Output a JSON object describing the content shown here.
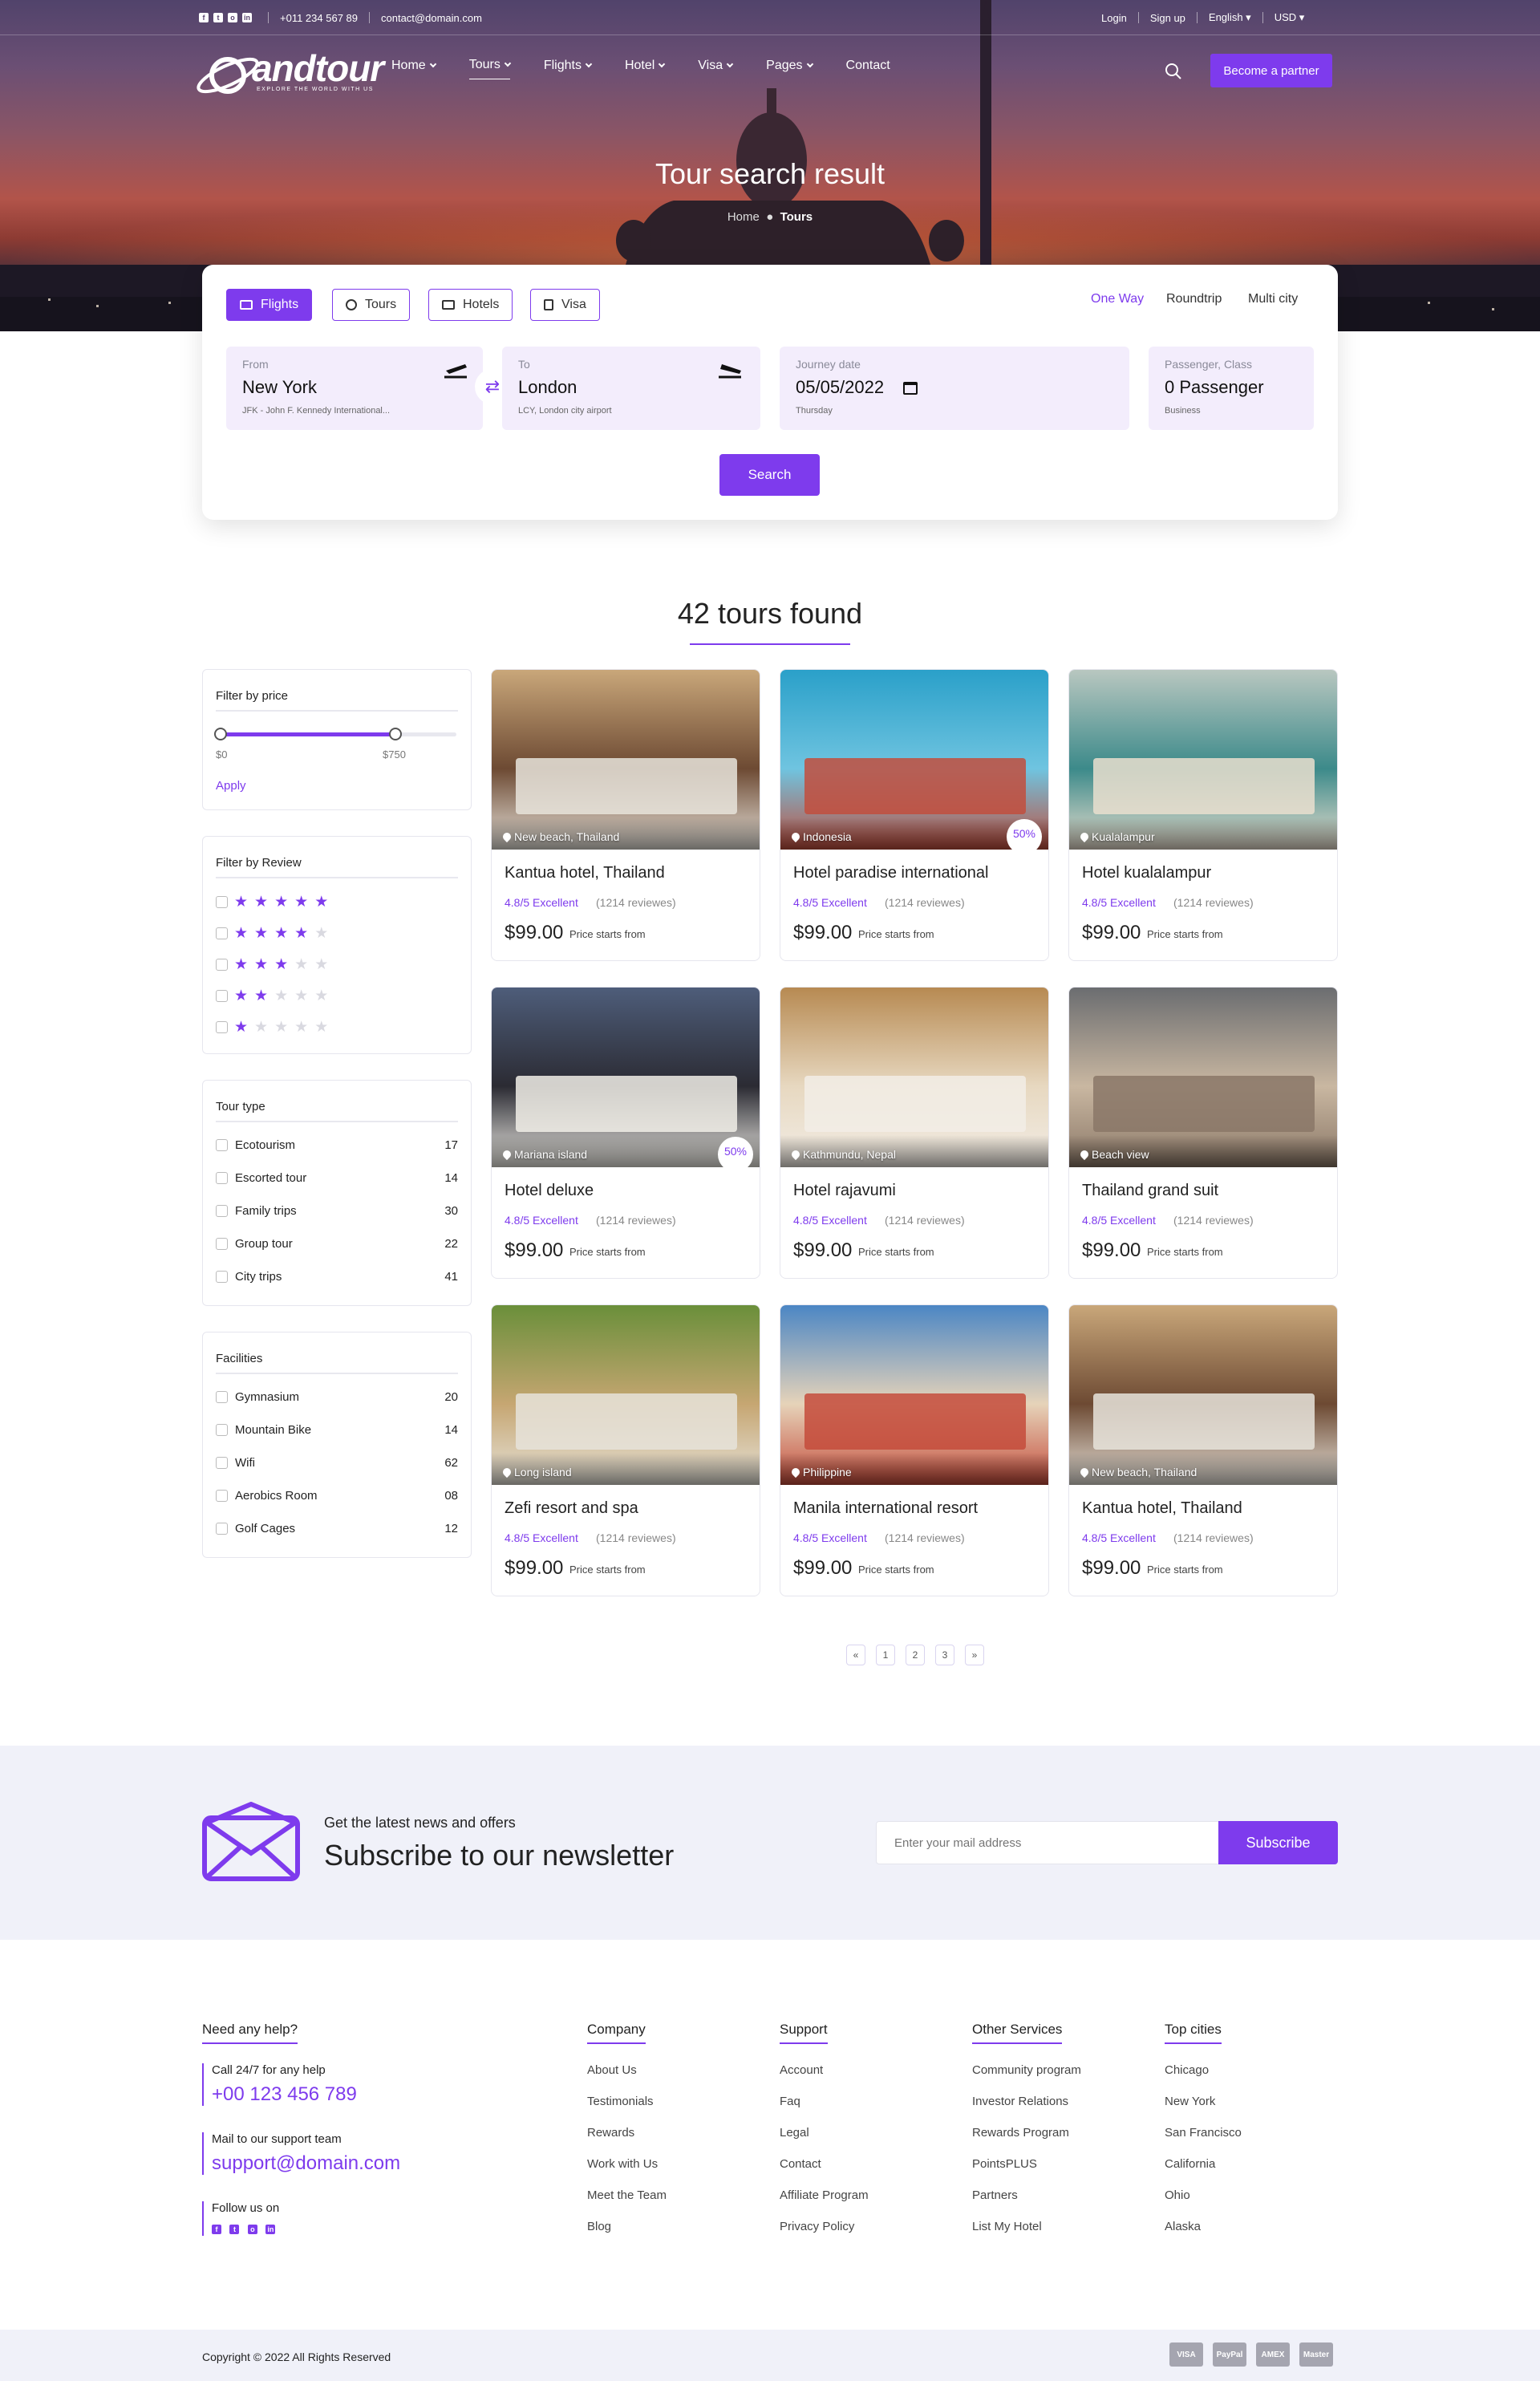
{
  "topbar": {
    "phone": "+011 234 567 89",
    "email": "contact@domain.com",
    "login": "Login",
    "signup": "Sign up",
    "language": "English",
    "currency": "USD"
  },
  "brand": {
    "name": "andtour",
    "tagline": "EXPLORE THE WORLD WITH US"
  },
  "nav": [
    {
      "label": "Home"
    },
    {
      "label": "Tours"
    },
    {
      "label": "Flights"
    },
    {
      "label": "Hotel"
    },
    {
      "label": "Visa"
    },
    {
      "label": "Pages"
    },
    {
      "label": "Contact"
    }
  ],
  "partner_button": "Become a partner",
  "hero": {
    "title": "Tour search result",
    "crumb_home": "Home",
    "crumb_current": "Tours"
  },
  "search": {
    "tabs": [
      "Flights",
      "Tours",
      "Hotels",
      "Visa"
    ],
    "trip_types": [
      "One Way",
      "Roundtrip",
      "Multi city"
    ],
    "from": {
      "label": "From",
      "value": "New York",
      "sub": "JFK - John F. Kennedy International..."
    },
    "to": {
      "label": "To",
      "value": "London",
      "sub": "LCY, London city airport"
    },
    "date": {
      "label": "Journey date",
      "value": "05/05/2022",
      "sub": "Thursday"
    },
    "pax": {
      "label": "Passenger, Class",
      "value": "0 Passenger",
      "sub": "Business"
    },
    "button": "Search"
  },
  "results_title": "42 tours found",
  "filters": {
    "price": {
      "title": "Filter by price",
      "min": "$0",
      "max": "$750",
      "apply": "Apply"
    },
    "review": {
      "title": "Filter by Review",
      "ratings": [
        5,
        4,
        3,
        2,
        1
      ]
    },
    "tour_type": {
      "title": "Tour type",
      "items": [
        {
          "label": "Ecotourism",
          "count": "17"
        },
        {
          "label": "Escorted tour",
          "count": "14"
        },
        {
          "label": "Family trips",
          "count": "30"
        },
        {
          "label": "Group tour",
          "count": "22"
        },
        {
          "label": "City trips",
          "count": "41"
        }
      ]
    },
    "facilities": {
      "title": "Facilities",
      "items": [
        {
          "label": "Gymnasium",
          "count": "20"
        },
        {
          "label": "Mountain Bike",
          "count": "14"
        },
        {
          "label": "Wifi",
          "count": "62"
        },
        {
          "label": "Aerobics Room",
          "count": "08"
        },
        {
          "label": "Golf Cages",
          "count": "12"
        }
      ]
    }
  },
  "tours": [
    {
      "name": "Kantua hotel, Thailand",
      "location": "New beach, Thailand",
      "rating": "4.8/5 Excellent",
      "reviews": "(1214 reviewes)",
      "price": "$99.00",
      "from": "Price starts from",
      "badge": ""
    },
    {
      "name": "Hotel paradise international",
      "location": "Indonesia",
      "rating": "4.8/5 Excellent",
      "reviews": "(1214 reviewes)",
      "price": "$99.00",
      "from": "Price starts from",
      "badge": "50%"
    },
    {
      "name": "Hotel kualalampur",
      "location": "Kualalampur",
      "rating": "4.8/5 Excellent",
      "reviews": "(1214 reviewes)",
      "price": "$99.00",
      "from": "Price starts from",
      "badge": ""
    },
    {
      "name": "Hotel deluxe",
      "location": "Mariana island",
      "rating": "4.8/5 Excellent",
      "reviews": "(1214 reviewes)",
      "price": "$99.00",
      "from": "Price starts from",
      "badge": "50%"
    },
    {
      "name": "Hotel rajavumi",
      "location": "Kathmundu, Nepal",
      "rating": "4.8/5 Excellent",
      "reviews": "(1214 reviewes)",
      "price": "$99.00",
      "from": "Price starts from",
      "badge": ""
    },
    {
      "name": "Thailand grand suit",
      "location": "Beach view",
      "rating": "4.8/5 Excellent",
      "reviews": "(1214 reviewes)",
      "price": "$99.00",
      "from": "Price starts from",
      "badge": ""
    },
    {
      "name": "Zefi resort and spa",
      "location": "Long island",
      "rating": "4.8/5 Excellent",
      "reviews": "(1214 reviewes)",
      "price": "$99.00",
      "from": "Price starts from",
      "badge": ""
    },
    {
      "name": "Manila international resort",
      "location": "Philippine",
      "rating": "4.8/5 Excellent",
      "reviews": "(1214 reviewes)",
      "price": "$99.00",
      "from": "Price starts from",
      "badge": ""
    },
    {
      "name": "Kantua hotel, Thailand",
      "location": "New beach, Thailand",
      "rating": "4.8/5 Excellent",
      "reviews": "(1214 reviewes)",
      "price": "$99.00",
      "from": "Price starts from",
      "badge": ""
    }
  ],
  "pagination": [
    "«",
    "1",
    "2",
    "3",
    "»"
  ],
  "newsletter": {
    "kicker": "Get the latest news and offers",
    "title": "Subscribe to our newsletter",
    "placeholder": "Enter your mail address",
    "button": "Subscribe"
  },
  "footer": {
    "help_title": "Need any help?",
    "call_label": "Call 24/7 for any help",
    "call_value": "+00 123 456 789",
    "mail_label": "Mail to our support team",
    "mail_value": "support@domain.com",
    "follow_label": "Follow us on",
    "columns": [
      {
        "title": "Company",
        "links": [
          "About Us",
          "Testimonials",
          "Rewards",
          "Work with Us",
          "Meet the Team",
          "Blog"
        ]
      },
      {
        "title": "Support",
        "links": [
          "Account",
          "Faq",
          "Legal",
          "Contact",
          "Affiliate Program",
          "Privacy Policy"
        ]
      },
      {
        "title": "Other Services",
        "links": [
          "Community program",
          "Investor Relations",
          "Rewards Program",
          "PointsPLUS",
          "Partners",
          "List My Hotel"
        ]
      },
      {
        "title": "Top cities",
        "links": [
          "Chicago",
          "New York",
          "San Francisco",
          "California",
          "Ohio",
          "Alaska"
        ]
      }
    ],
    "copyright": "Copyright © 2022 All Rights Reserved",
    "payments": [
      "VISA",
      "PayPal",
      "AMEX",
      "Master"
    ]
  },
  "colors": {
    "accent": "#7e3bed",
    "accent_light": "#f3edfc",
    "newsletter_bg": "#f0f1f9"
  }
}
